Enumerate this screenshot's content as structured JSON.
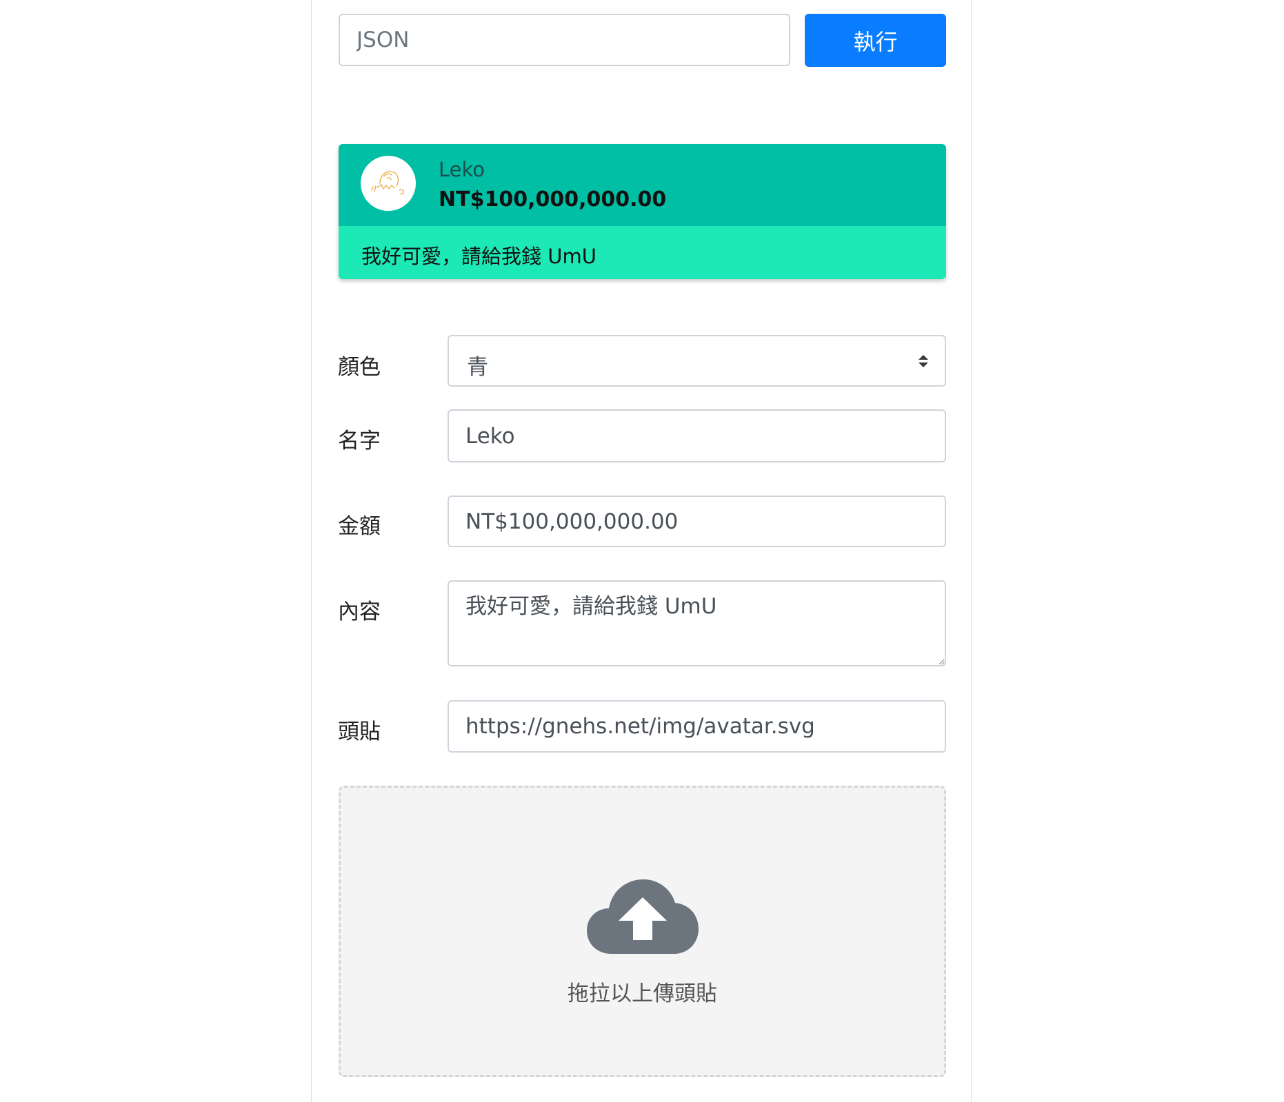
{
  "toolbar": {
    "json_placeholder": "JSON",
    "run_label": "執行"
  },
  "preview": {
    "name": "Leko",
    "amount": "NT$100,000,000.00",
    "message": "我好可愛，請給我錢 UmU",
    "header_color": "#00bfa5",
    "body_color": "#1de9b6"
  },
  "form": {
    "color": {
      "label": "顏色",
      "value": "青"
    },
    "name": {
      "label": "名字",
      "value": "Leko"
    },
    "amount": {
      "label": "金額",
      "value": "NT$100,000,000.00"
    },
    "content": {
      "label": "內容",
      "value": "我好可愛，請給我錢 UmU"
    },
    "avatar": {
      "label": "頭貼",
      "value": "https://gnehs.net/img/avatar.svg"
    }
  },
  "upload": {
    "label": "拖拉以上傳頭貼",
    "icon": "cloud-upload-icon"
  },
  "colors": {
    "primary_button": "#0a7cff",
    "upload_icon": "#6c757d"
  }
}
